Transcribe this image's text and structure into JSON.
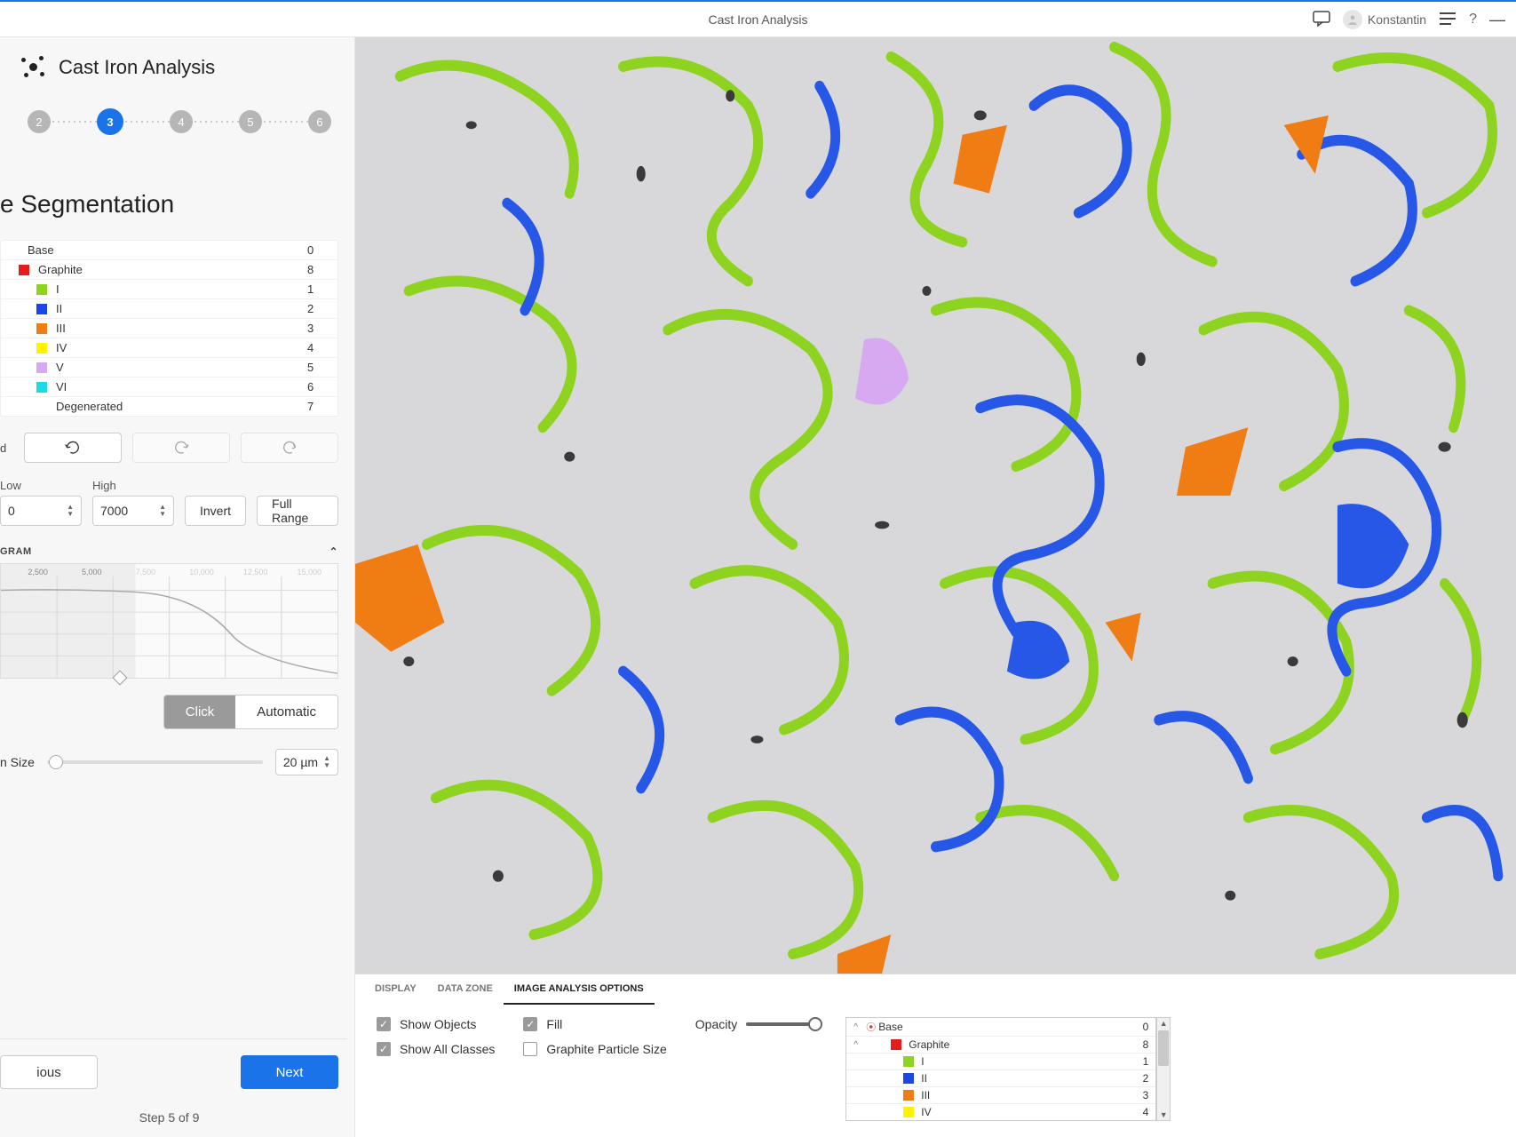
{
  "window": {
    "title": "Cast Iron Analysis",
    "user": "Konstantin"
  },
  "sidebar": {
    "title": "Cast Iron Analysis",
    "steps": [
      "2",
      "3",
      "4",
      "5",
      "6"
    ],
    "active_step_index": 1,
    "section_title": "e Segmentation",
    "classes": [
      {
        "indent": 0,
        "swatch": "",
        "label": "Base",
        "num": "0"
      },
      {
        "indent": 1,
        "swatch": "#e51c1c",
        "label": "Graphite",
        "num": "8"
      },
      {
        "indent": 2,
        "swatch": "#8fd321",
        "label": "I",
        "num": "1"
      },
      {
        "indent": 2,
        "swatch": "#1a48e0",
        "label": "II",
        "num": "2"
      },
      {
        "indent": 2,
        "swatch": "#f07c14",
        "label": "III",
        "num": "3"
      },
      {
        "indent": 2,
        "swatch": "#fff200",
        "label": "IV",
        "num": "4"
      },
      {
        "indent": 2,
        "swatch": "#d6a9f0",
        "label": "V",
        "num": "5"
      },
      {
        "indent": 2,
        "swatch": "#1fd8e6",
        "label": "VI",
        "num": "6"
      },
      {
        "indent": 2,
        "swatch": "",
        "label": "Degenerated",
        "num": "7"
      }
    ],
    "threshold_label": "d",
    "range": {
      "low_label": "Low",
      "low_value": "0",
      "high_label": "High",
      "high_value": "7000",
      "invert": "Invert",
      "full_range": "Full Range"
    },
    "histogram": {
      "title": "GRAM",
      "ticks": [
        "2,500",
        "5,000",
        "7,500",
        "10,000",
        "12,500",
        "15,000"
      ]
    },
    "mode": {
      "click": "Click",
      "automatic": "Automatic"
    },
    "min_size": {
      "label": "n Size",
      "value": "20 µm"
    },
    "nav": {
      "prev": "ious",
      "next": "Next",
      "step_text": "Step 5 of 9"
    }
  },
  "bottom_panel": {
    "tabs": [
      "DISPLAY",
      "DATA ZONE",
      "IMAGE ANALYSIS OPTIONS"
    ],
    "active_tab": 2,
    "checks": {
      "show_objects": "Show Objects",
      "show_all_classes": "Show All Classes",
      "fill": "Fill",
      "graphite_particle_size": "Graphite Particle Size",
      "opacity": "Opacity"
    },
    "mini_tree": [
      {
        "caret": "^",
        "target": "*",
        "swatch": "",
        "label": "Base",
        "num": "0"
      },
      {
        "caret": "^",
        "target": "",
        "swatch": "#e51c1c",
        "label": "Graphite",
        "num": "8",
        "indent": 1
      },
      {
        "caret": "",
        "target": "",
        "swatch": "#8fd321",
        "label": "I",
        "num": "1",
        "indent": 2
      },
      {
        "caret": "",
        "target": "",
        "swatch": "#1a48e0",
        "label": "II",
        "num": "2",
        "indent": 2
      },
      {
        "caret": "",
        "target": "",
        "swatch": "#f07c14",
        "label": "III",
        "num": "3",
        "indent": 2
      },
      {
        "caret": "",
        "target": "",
        "swatch": "#fff200",
        "label": "IV",
        "num": "4",
        "indent": 2
      }
    ]
  }
}
